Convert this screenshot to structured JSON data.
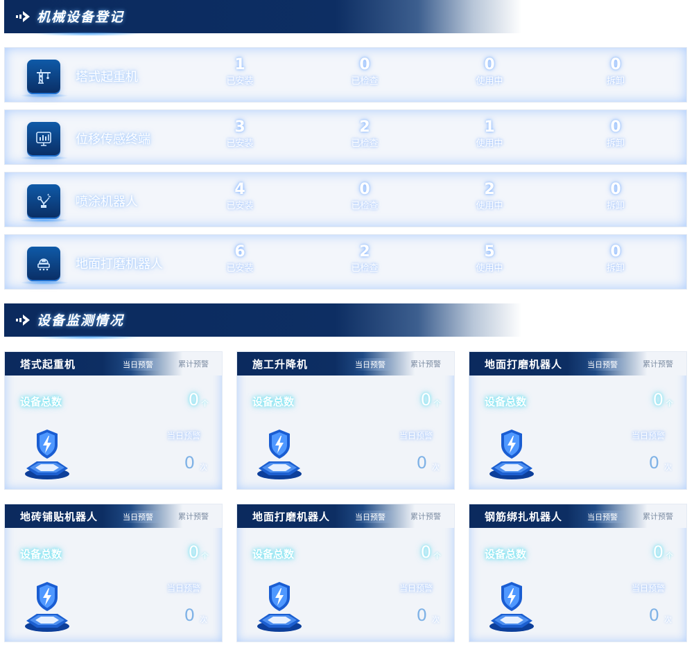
{
  "registration": {
    "title": "机械设备登记",
    "rows": [
      {
        "name": "塔式起重机",
        "icon": "tower-crane-icon",
        "stats": [
          {
            "value": "1",
            "label": "已安装"
          },
          {
            "value": "0",
            "label": "已检查"
          },
          {
            "value": "0",
            "label": "使用中"
          },
          {
            "value": "0",
            "label": "拆卸"
          }
        ]
      },
      {
        "name": "位移传感终端",
        "icon": "bar-chart-monitor-icon",
        "stats": [
          {
            "value": "3",
            "label": "已安装"
          },
          {
            "value": "2",
            "label": "已检查"
          },
          {
            "value": "1",
            "label": "使用中"
          },
          {
            "value": "0",
            "label": "拆卸"
          }
        ]
      },
      {
        "name": "喷涂机器人",
        "icon": "robot-arm-icon",
        "stats": [
          {
            "value": "4",
            "label": "已安装"
          },
          {
            "value": "0",
            "label": "已检查"
          },
          {
            "value": "2",
            "label": "使用中"
          },
          {
            "value": "0",
            "label": "拆卸"
          }
        ]
      },
      {
        "name": "地面打磨机器人",
        "icon": "floor-robot-icon",
        "stats": [
          {
            "value": "6",
            "label": "已安装"
          },
          {
            "value": "2",
            "label": "已检查"
          },
          {
            "value": "5",
            "label": "使用中"
          },
          {
            "value": "0",
            "label": "拆卸"
          }
        ]
      }
    ]
  },
  "monitoring": {
    "title": "设备监测情况",
    "tab_today": "当日预警",
    "tab_total": "累计预警",
    "total_label": "设备总数",
    "today_label": "当日预警",
    "cards": [
      {
        "title": "塔式起重机",
        "total": "0",
        "total_unit": "个",
        "today": "0",
        "today_unit": "次"
      },
      {
        "title": "施工升降机",
        "total": "0",
        "total_unit": "个",
        "today": "0",
        "today_unit": "次"
      },
      {
        "title": "地面打磨机器人",
        "total": "0",
        "total_unit": "个",
        "today": "0",
        "today_unit": "次"
      },
      {
        "title": "地砖铺贴机器人",
        "total": "0",
        "total_unit": "个",
        "today": "0",
        "today_unit": "次"
      },
      {
        "title": "地面打磨机器人",
        "total": "0",
        "total_unit": "个",
        "today": "0",
        "today_unit": "次"
      },
      {
        "title": "钢筋绑扎机器人",
        "total": "0",
        "total_unit": "个",
        "today": "0",
        "today_unit": "次"
      }
    ]
  },
  "colors": {
    "header_navy": "#0b2a5e",
    "row_background": "#f3f6fb",
    "glow_blue": "#82b4ff",
    "glow_cyan": "#5ae6f0",
    "today_value": "#7fb2e6"
  }
}
